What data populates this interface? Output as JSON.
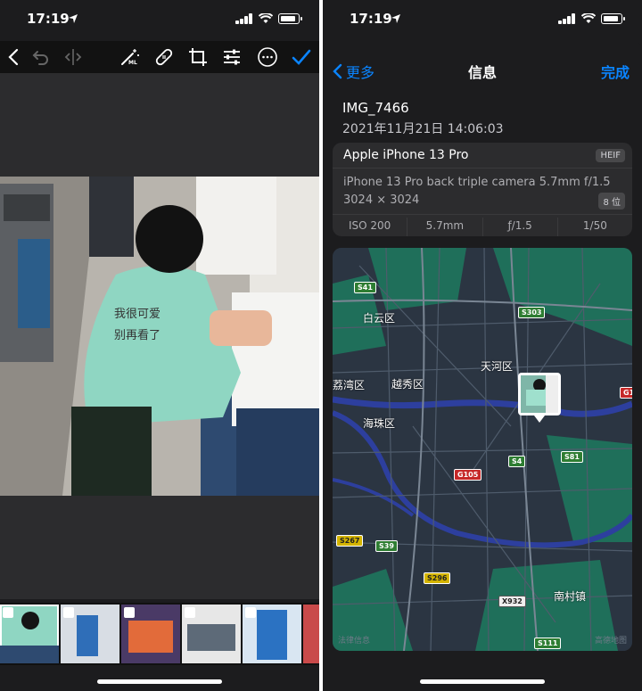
{
  "left_screen": {
    "status": {
      "time": "17:19"
    },
    "toolbar": {
      "items": [
        "back-chevron-icon",
        "undo-icon",
        "compare-icon",
        "magic-wand-ml-icon",
        "bandage-icon",
        "crop-icon",
        "adjust-sliders-icon",
        "more-icon",
        "done-check-icon"
      ],
      "ml_label": "ML"
    },
    "photo_text": "我很可爱 别再看了",
    "filmstrip_count": 6
  },
  "right_screen": {
    "status": {
      "time": "17:19"
    },
    "nav": {
      "back_label": "更多",
      "title": "信息",
      "done_label": "完成"
    },
    "file": {
      "name": "IMG_7466",
      "datetime": "2021年11月21日 14:06:03"
    },
    "camera": {
      "model": "Apple iPhone 13 Pro",
      "format_badge": "HEIF",
      "lens": "iPhone 13 Pro back triple camera 5.7mm f/1.5",
      "resolution": "3024 × 3024",
      "bit_badge": "8 位",
      "exif": [
        "ISO 200",
        "5.7mm",
        "ƒ/1.5",
        "1/50"
      ]
    },
    "map": {
      "districts": [
        "白云区",
        "天河区",
        "越秀区",
        "荔湾区",
        "海珠区",
        "南村镇"
      ],
      "shields": {
        "s41": "S41",
        "s303": "S303",
        "s4": "S4",
        "s81": "S81",
        "g105": "G105",
        "s267": "S267",
        "s39": "S39",
        "s296": "S296",
        "x932": "X932",
        "s111": "S111",
        "g1": "G1"
      },
      "legal": "法律信息",
      "brand": "高德地图"
    }
  },
  "colors": {
    "accent": "#0a84ff",
    "sheet_bg": "#1c1c1e",
    "card_bg": "#2c2c2e"
  }
}
